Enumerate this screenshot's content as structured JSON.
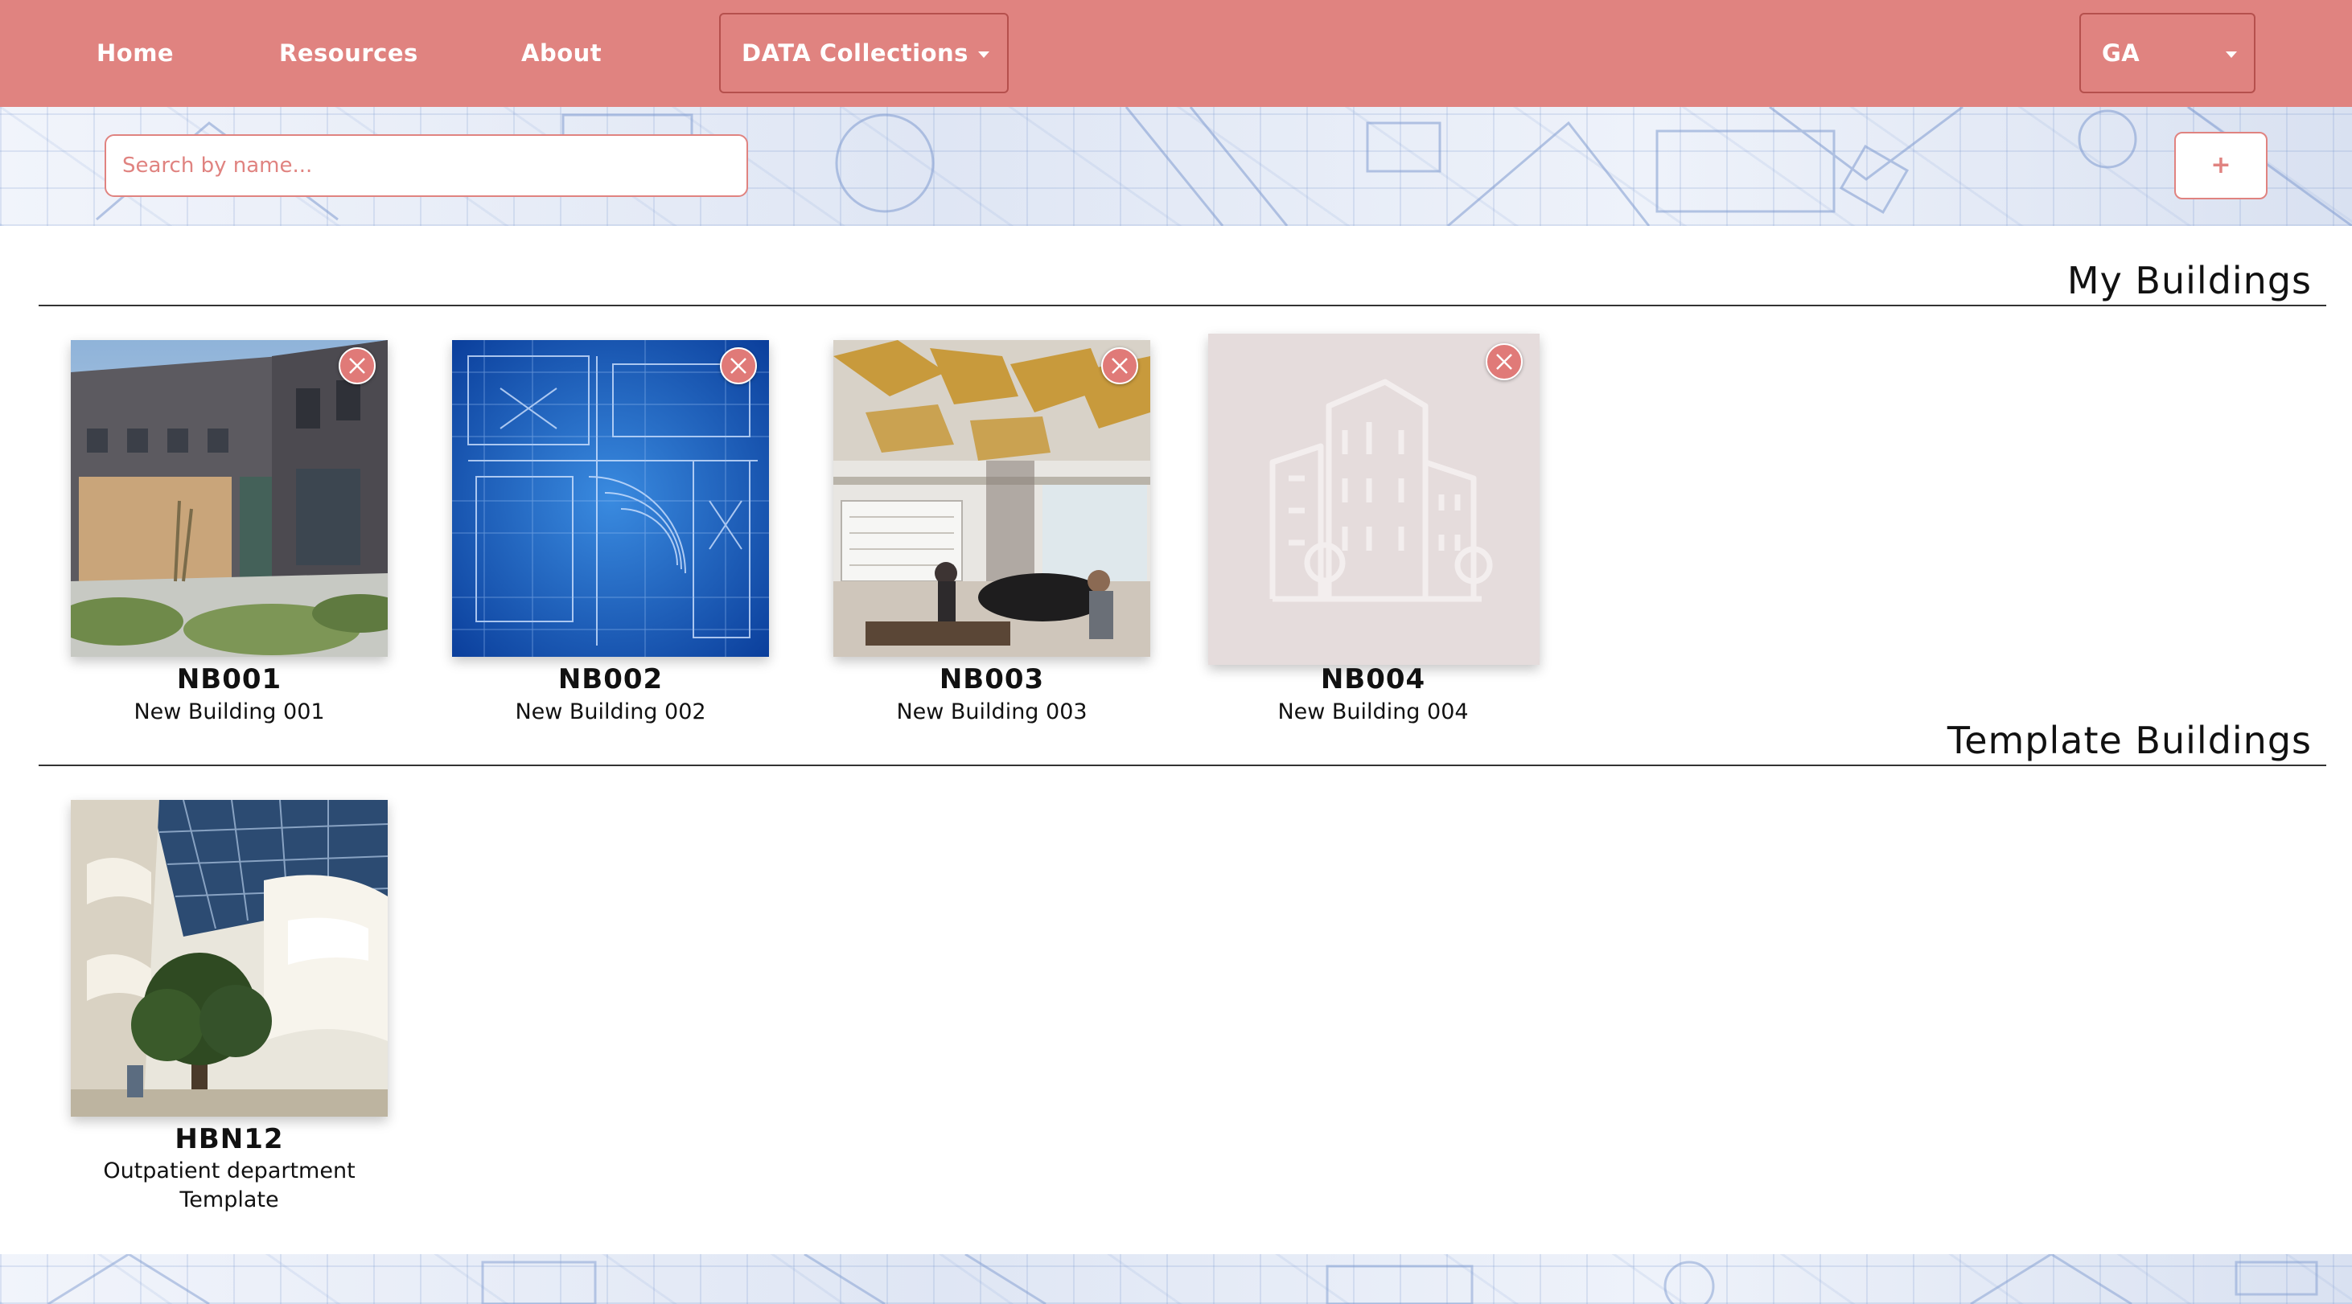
{
  "navbar": {
    "links": [
      "Home",
      "Resources",
      "About"
    ],
    "data_collections_label": "DATA Collections",
    "user_label": "GA",
    "bg_color": "#e08380"
  },
  "search": {
    "placeholder": "Search by name..."
  },
  "add_button": {
    "icon": "plus-icon",
    "label": "+"
  },
  "sections": {
    "my_buildings": {
      "title": "My Buildings",
      "items": [
        {
          "code": "NB001",
          "name": "New Building 001",
          "image": "building-exterior-photo"
        },
        {
          "code": "NB002",
          "name": "New Building 002",
          "image": "blueprint-photo"
        },
        {
          "code": "NB003",
          "name": "New Building 003",
          "image": "music-room-photo"
        },
        {
          "code": "NB004",
          "name": "New Building 004",
          "image": "building-placeholder-icon"
        }
      ]
    },
    "template_buildings": {
      "title": "Template Buildings",
      "items": [
        {
          "code": "HBN12",
          "name_line1": "Outpatient department",
          "name_line2": "Template",
          "image": "atrium-photo"
        }
      ]
    }
  },
  "icons": {
    "delete": "close-circle-icon",
    "caret": "caret-down-icon"
  },
  "colors": {
    "accent": "#e08380",
    "delete_button": "#e07a78",
    "placeholder_bg": "#e5dcdc"
  }
}
